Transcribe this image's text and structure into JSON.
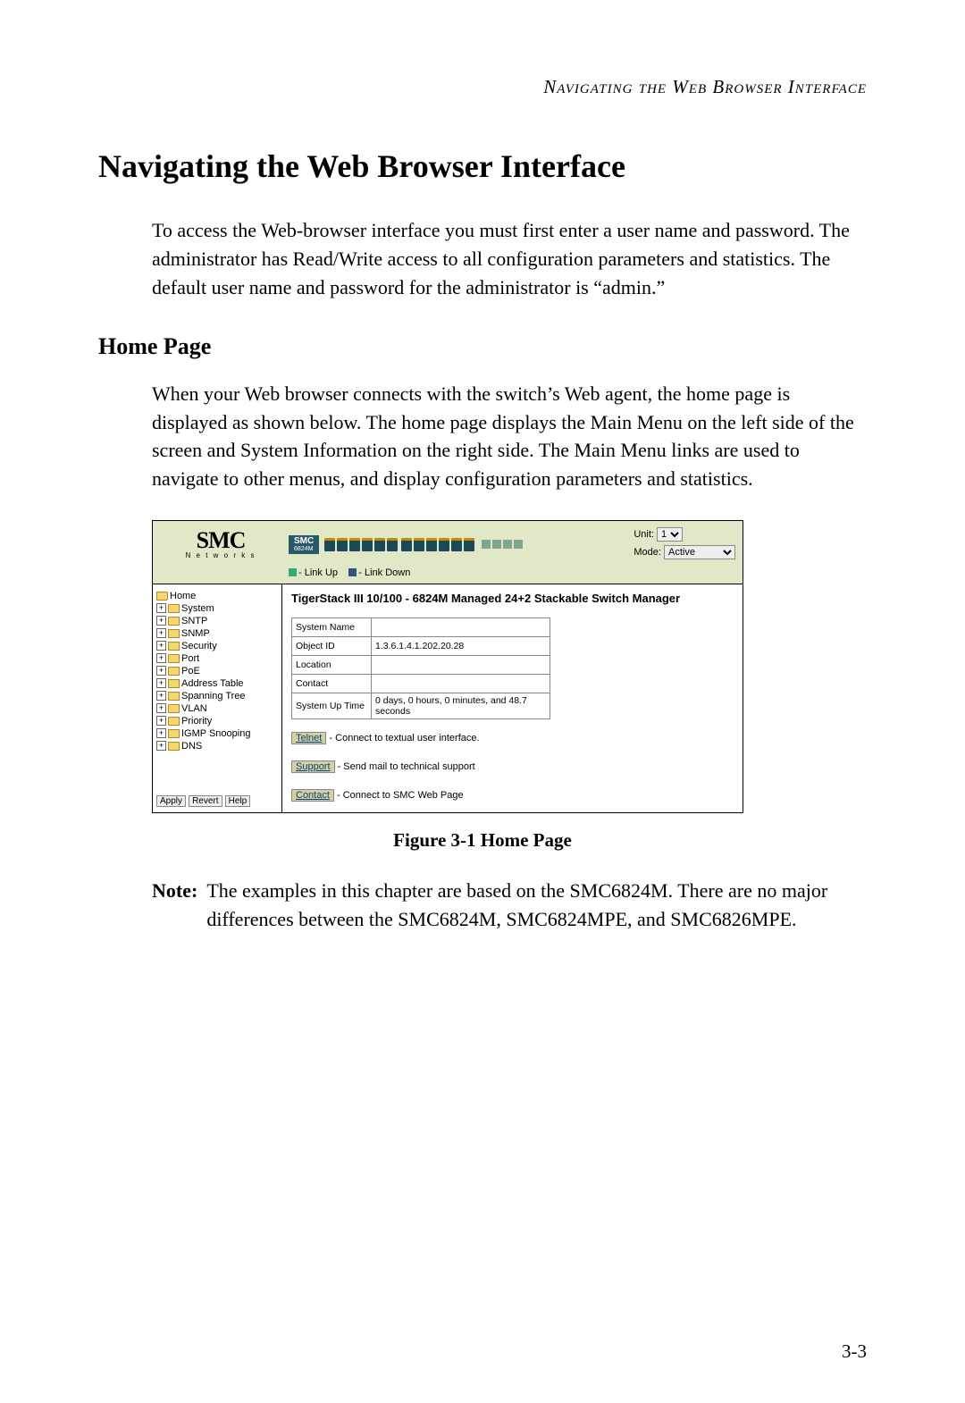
{
  "running_head": "Navigating the Web Browser Interface",
  "title": "Navigating the Web Browser Interface",
  "intro": "To access the Web-browser interface you must first enter a user name and password. The administrator has Read/Write access to all configuration parameters and statistics. The default user name and password for the administrator is “admin.”",
  "subhead": "Home Page",
  "sub_body": "When your Web browser connects with the switch’s Web agent, the home page is displayed as shown below. The home page displays the Main Menu on the left side of the screen and System Information on the right side. The Main Menu links are used to navigate to other menus, and display configuration parameters and statistics.",
  "screenshot": {
    "logo_main": "SMC",
    "logo_sub": "N e t w o r k s",
    "mini_logo": "SMC",
    "mini_sub": "6824M",
    "unit_label": "Unit:",
    "unit_value": "1",
    "mode_label": "Mode:",
    "mode_value": "Active",
    "legend_up": "- Link Up",
    "legend_down": "- Link Down",
    "tree": [
      {
        "label": "Home",
        "home": true
      },
      {
        "label": "System"
      },
      {
        "label": "SNTP"
      },
      {
        "label": "SNMP"
      },
      {
        "label": "Security"
      },
      {
        "label": "Port"
      },
      {
        "label": "PoE"
      },
      {
        "label": "Address Table"
      },
      {
        "label": "Spanning Tree"
      },
      {
        "label": "VLAN"
      },
      {
        "label": "Priority"
      },
      {
        "label": "IGMP Snooping"
      },
      {
        "label": "DNS"
      }
    ],
    "btn_apply": "Apply",
    "btn_revert": "Revert",
    "btn_help": "Help",
    "main_heading": "TigerStack III 10/100 - 6824M Managed 24+2 Stackable Switch Manager",
    "sys_rows": [
      {
        "label": "System Name",
        "value": ""
      },
      {
        "label": "Object ID",
        "value": "1.3.6.1.4.1.202.20.28"
      },
      {
        "label": "Location",
        "value": ""
      },
      {
        "label": "Contact",
        "value": ""
      },
      {
        "label": "System Up Time",
        "value": "0 days, 0 hours, 0 minutes, and 48.7 seconds"
      }
    ],
    "links": [
      {
        "name": "Telnet",
        "desc": "- Connect to textual user interface."
      },
      {
        "name": "Support",
        "desc": "- Send mail to technical support"
      },
      {
        "name": "Contact",
        "desc": "- Connect to SMC Web Page"
      }
    ]
  },
  "figure_caption": "Figure 3-1  Home Page",
  "note_label": "Note:",
  "note_text": "The examples in this chapter are based on the SMC6824M. There are no major differences between the SMC6824M, SMC6824MPE, and SMC6826MPE.",
  "page_number": "3-3"
}
